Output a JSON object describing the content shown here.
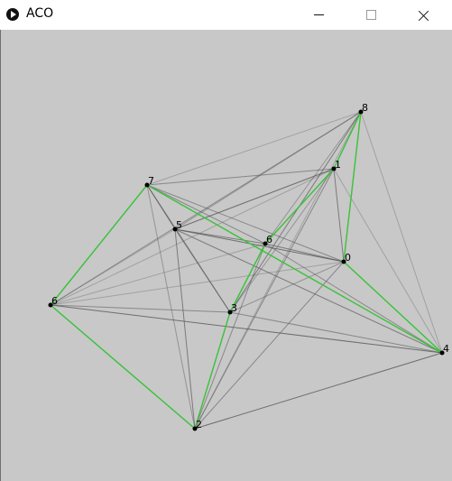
{
  "window": {
    "title": "ACO",
    "app_icon": "play-circle-icon",
    "controls": [
      "minimize-icon",
      "maximize-icon",
      "close-icon"
    ]
  },
  "colors": {
    "background": "#c8c8c8",
    "titlebar": "#ffffff",
    "best_path": "#39c439",
    "edge": "#5a5a5a",
    "node": "#000000"
  },
  "graph": {
    "nodes": [
      {
        "label": "0"
      },
      {
        "label": "1"
      },
      {
        "label": "2"
      },
      {
        "label": "3"
      },
      {
        "label": "4"
      },
      {
        "label": "5"
      },
      {
        "label": "6"
      },
      {
        "label": "7"
      },
      {
        "label": "8"
      },
      {
        "label": "6"
      }
    ],
    "best_tour": [
      7,
      9,
      2,
      3,
      6,
      1,
      8,
      0,
      4
    ]
  }
}
